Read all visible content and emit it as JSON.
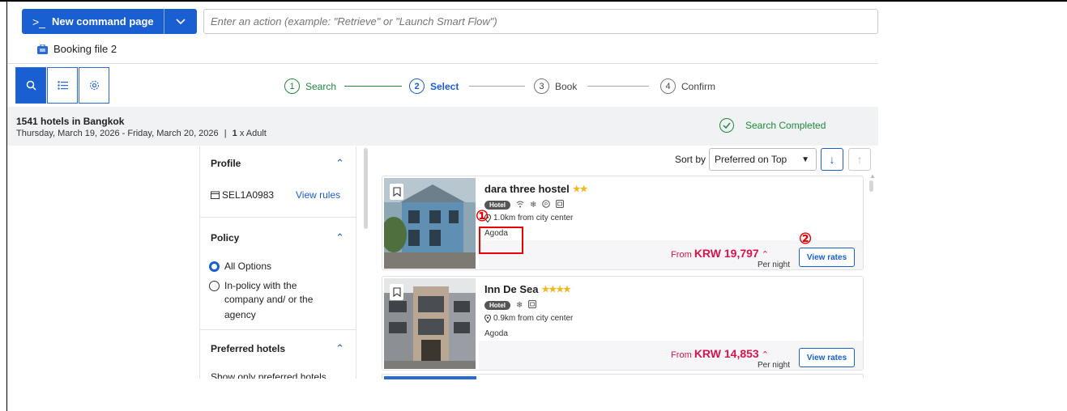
{
  "command_bar": {
    "new_command_label": "New command page",
    "prompt_symbol": ">_",
    "input_placeholder": "Enter an action (example: \"Retrieve\" or \"Launch Smart Flow\")"
  },
  "booking_file": "Booking file 2",
  "stepper": [
    {
      "num": "1",
      "label": "Search",
      "state": "done"
    },
    {
      "num": "2",
      "label": "Select",
      "state": "current"
    },
    {
      "num": "3",
      "label": "Book",
      "state": "todo"
    },
    {
      "num": "4",
      "label": "Confirm",
      "state": "todo"
    }
  ],
  "results": {
    "count_title": "1541 hotels in Bangkok",
    "dates": "Thursday, March 19, 2026  - Friday, March 20, 2026",
    "separator": "|",
    "travelers_count": "1",
    "travelers_label": "x Adult",
    "status": "Search Completed"
  },
  "filters": {
    "profile_title": "Profile",
    "profile_code": "SEL1A0983",
    "view_rules": "View rules",
    "policy_title": "Policy",
    "policy_options": [
      "All Options",
      "In-policy with the",
      "company and/ or the",
      "agency"
    ],
    "preferred_title": "Preferred hotels",
    "preferred_text": "Show only preferred hotels"
  },
  "sort": {
    "label": "Sort by",
    "selected": "Preferred on Top"
  },
  "hotels": [
    {
      "name": "dara three hostel",
      "stars": 2,
      "stars_glyph": "★★",
      "type_badge": "Hotel",
      "distance": "1.0km from city center",
      "source": "Agoda",
      "from_label": "From",
      "price": "KRW 19,797",
      "per_night": "Per night",
      "view_rates": "View rates"
    },
    {
      "name": "Inn De Sea",
      "stars": 4,
      "stars_glyph": "★★★★",
      "type_badge": "Hotel",
      "distance": "0.9km from city center",
      "source": "Agoda",
      "from_label": "From",
      "price": "KRW 14,853",
      "per_night": "Per night",
      "view_rates": "View rates"
    }
  ],
  "annotations": {
    "marker_1": "①",
    "marker_2": "②"
  },
  "colors": {
    "primary": "#1a5fd1",
    "success": "#1d8a3b",
    "price": "#d6144c",
    "annotation": "#e00000"
  }
}
